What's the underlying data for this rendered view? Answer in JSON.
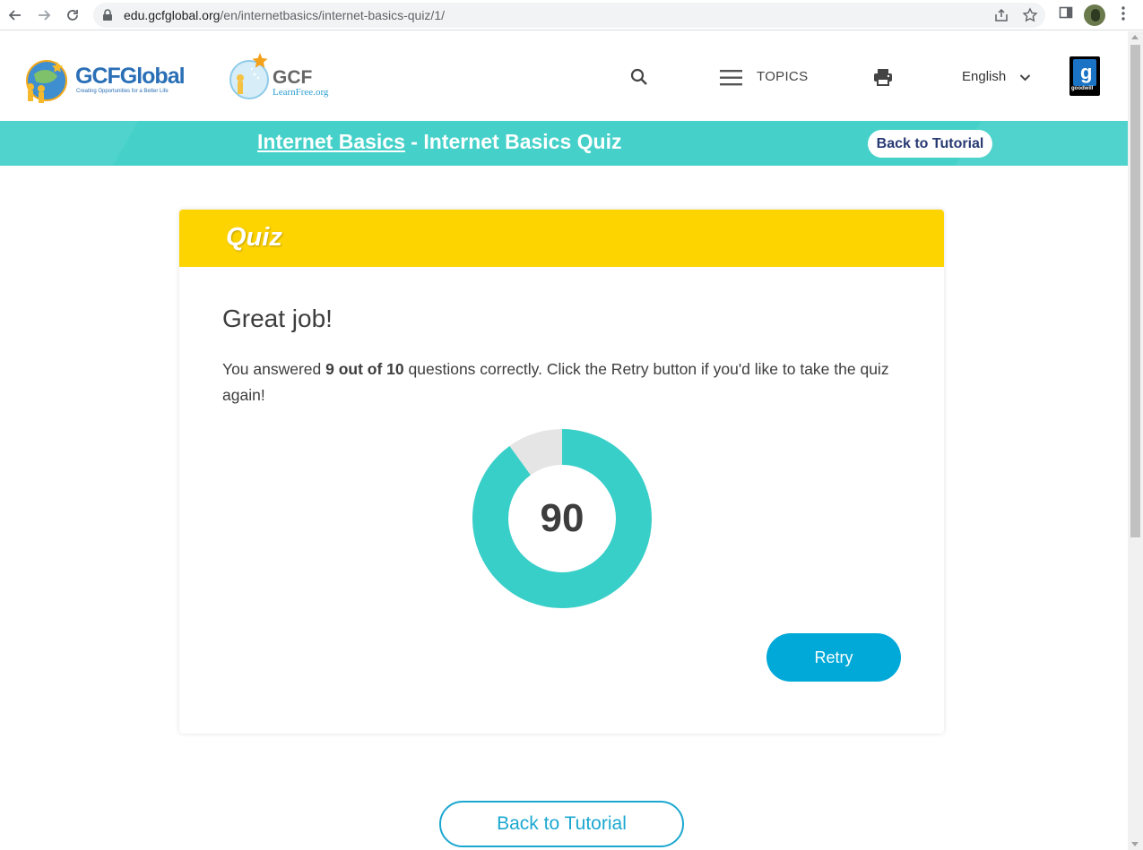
{
  "browser": {
    "url_domain": "edu.gcfglobal.org",
    "url_path": "/en/internetbasics/internet-basics-quiz/1/"
  },
  "header": {
    "logo_gcfglobal": "GCFGlobal",
    "logo_gcfglobal_tagline": "Creating Opportunities for a Better Life",
    "logo_learnfree_title": "GCF",
    "logo_learnfree_sub": "LearnFree.org",
    "topics_label": "TOPICS",
    "language": "English",
    "goodwill_label": "goodwill"
  },
  "breadcrumb": {
    "link": "Internet Basics",
    "separator": " - ",
    "current": "Internet Basics Quiz",
    "back_button": "Back to Tutorial"
  },
  "quiz": {
    "title": "Quiz",
    "heading": "Great job!",
    "text_before": "You answered ",
    "score_phrase": "9 out of 10",
    "text_after": " questions correctly. Click the Retry button if you'd like to take the quiz again!",
    "score": "90",
    "score_fraction": 0.9,
    "retry_label": "Retry"
  },
  "footer": {
    "back_button": "Back to Tutorial"
  },
  "colors": {
    "teal": "#45d1c9",
    "donut_fill": "#38cfc9",
    "donut_empty": "#e5e5e5",
    "yellow": "#fed400",
    "retry": "#00a9d8"
  }
}
